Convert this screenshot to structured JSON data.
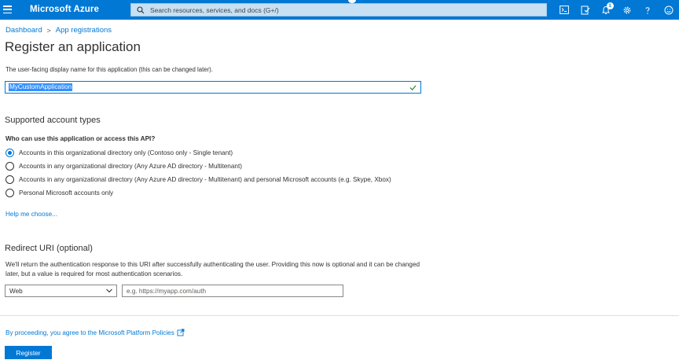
{
  "topbar": {
    "brand": "Microsoft Azure",
    "search_placeholder": "Search resources, services, and docs (G+/)",
    "notification_count": "1",
    "icons": [
      "menu-icon",
      "search-icon",
      "cloud-shell-icon",
      "directory-filter-icon",
      "notifications-icon",
      "settings-icon",
      "help-icon",
      "feedback-icon"
    ],
    "colors": {
      "bar": "#0078d4",
      "search_bg": "#c7e0f4"
    }
  },
  "breadcrumb": {
    "items": [
      "Dashboard",
      "App registrations"
    ],
    "separator": ">"
  },
  "page": {
    "title": "Register an application",
    "name_description": "The user-facing display name for this application (this can be changed later).",
    "name_value": "MyCustomApplication"
  },
  "account_types": {
    "heading": "Supported account types",
    "question": "Who can use this application or access this API?",
    "options": [
      {
        "label": "Accounts in this organizational directory only (Contoso only - Single tenant)",
        "checked": true
      },
      {
        "label": "Accounts in any organizational directory (Any Azure AD directory - Multitenant)",
        "checked": false
      },
      {
        "label": "Accounts in any organizational directory (Any Azure AD directory - Multitenant) and personal Microsoft accounts (e.g. Skype, Xbox)",
        "checked": false
      },
      {
        "label": "Personal Microsoft accounts only",
        "checked": false
      }
    ],
    "help_link": "Help me choose..."
  },
  "redirect": {
    "heading": "Redirect URI (optional)",
    "description": "We'll return the authentication response to this URI after successfully authenticating the user. Providing this now is optional and it can be changed later, but a value is required for most authentication scenarios.",
    "platform_value": "Web",
    "uri_placeholder": "e.g. https://myapp.com/auth"
  },
  "footer": {
    "policy_text": "By proceeding, you agree to the Microsoft Platform Policies",
    "register_label": "Register"
  },
  "colors": {
    "accent": "#0078d4",
    "text": "#323130",
    "selection": "#3390ff"
  }
}
